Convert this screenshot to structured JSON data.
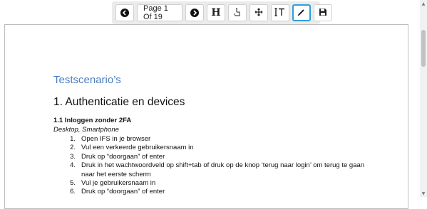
{
  "toolbar": {
    "prev_icon": "prev-page-icon",
    "page_indicator": "Page 1 Of 19",
    "next_icon": "next-page-icon",
    "heading_label": "H",
    "tools": [
      "heading-tool-icon",
      "pointer-hand-icon",
      "move-icon",
      "text-tool-icon",
      "pen-icon",
      "save-icon"
    ],
    "active_tool": "pen",
    "active_color": "#2f9fd8"
  },
  "document": {
    "title": "Testscenario’s",
    "heading1": "1. Authenticatie en devices",
    "heading2": "1.1 Inloggen zonder 2FA",
    "subtitle": "Desktop, Smartphone",
    "steps": [
      {
        "num": "1.",
        "text": "Open IFS in je browser"
      },
      {
        "num": "2.",
        "text": "Vul een verkeerde gebruikersnaam in"
      },
      {
        "num": "3.",
        "text": "Druk op “doorgaan” of enter"
      },
      {
        "num": "4.",
        "text": "Druk in het wachtwoordveld op shift+tab of druk op de knop ‘terug naar login’ om terug te gaan naar het eerste scherm"
      },
      {
        "num": "5.",
        "text": "Vul je gebruikersnaam in"
      },
      {
        "num": "6.",
        "text": "Druk op “doorgaan” of enter"
      }
    ],
    "title_color": "#4a7fc1"
  }
}
